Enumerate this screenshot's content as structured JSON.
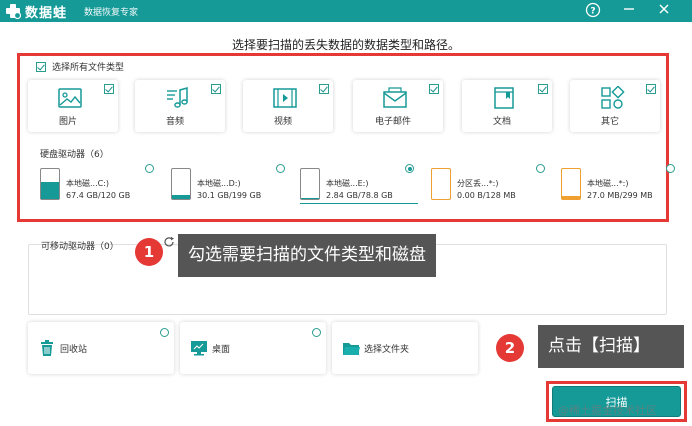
{
  "app": {
    "name": "数据蛙",
    "subtitle": "数据恢复专家"
  },
  "window_controls": {
    "help": "?",
    "minimize": "—",
    "close": "✕"
  },
  "headline": "选择要扫描的丢失数据的数据类型和路径。",
  "select_all": {
    "label": "选择所有文件类型",
    "checked": true
  },
  "file_types": [
    {
      "label": "图片",
      "icon": "image-icon",
      "checked": true
    },
    {
      "label": "音频",
      "icon": "music-icon",
      "checked": true
    },
    {
      "label": "视频",
      "icon": "video-icon",
      "checked": true
    },
    {
      "label": "电子邮件",
      "icon": "mail-icon",
      "checked": true
    },
    {
      "label": "文档",
      "icon": "document-icon",
      "checked": true
    },
    {
      "label": "其它",
      "icon": "others-icon",
      "checked": true
    }
  ],
  "hard_drives": {
    "title": "硬盘驱动器（6）",
    "items": [
      {
        "name": "本地磁...C:)",
        "size": "67.4 GB/120 GB",
        "fill_percent": 56,
        "selected": false,
        "color": "#169a98"
      },
      {
        "name": "本地磁...D:)",
        "size": "30.1 GB/199 GB",
        "fill_percent": 15,
        "selected": false,
        "color": "#169a98"
      },
      {
        "name": "本地磁...E:)",
        "size": "2.84 GB/78.8 GB",
        "fill_percent": 4,
        "selected": true,
        "color": "#169a98"
      },
      {
        "name": "分区丢...*:)",
        "size": "0.00  B/128 MB",
        "fill_percent": 0,
        "selected": false,
        "color": "#f0a030"
      },
      {
        "name": "本地磁...*:)",
        "size": "27.0 MB/299 MB",
        "fill_percent": 9,
        "selected": false,
        "color": "#f0a030"
      }
    ]
  },
  "removable": {
    "title": "可移动驱动器（0）"
  },
  "locations": [
    {
      "label": "回收站",
      "icon": "trash-icon"
    },
    {
      "label": "桌面",
      "icon": "desktop-icon"
    },
    {
      "label": "选择文件夹",
      "icon": "folder-icon"
    }
  ],
  "tutorial": {
    "step1_num": "1",
    "step1_text": "勾选需要扫描的文件类型和磁盘",
    "step2_num": "2",
    "step2_text": "点击【扫描】"
  },
  "scan_button": "扫描",
  "watermark": "@稀土掘金技术社区",
  "colors": {
    "accent": "#169a98",
    "highlight": "#e53935",
    "callout": "#555555"
  }
}
